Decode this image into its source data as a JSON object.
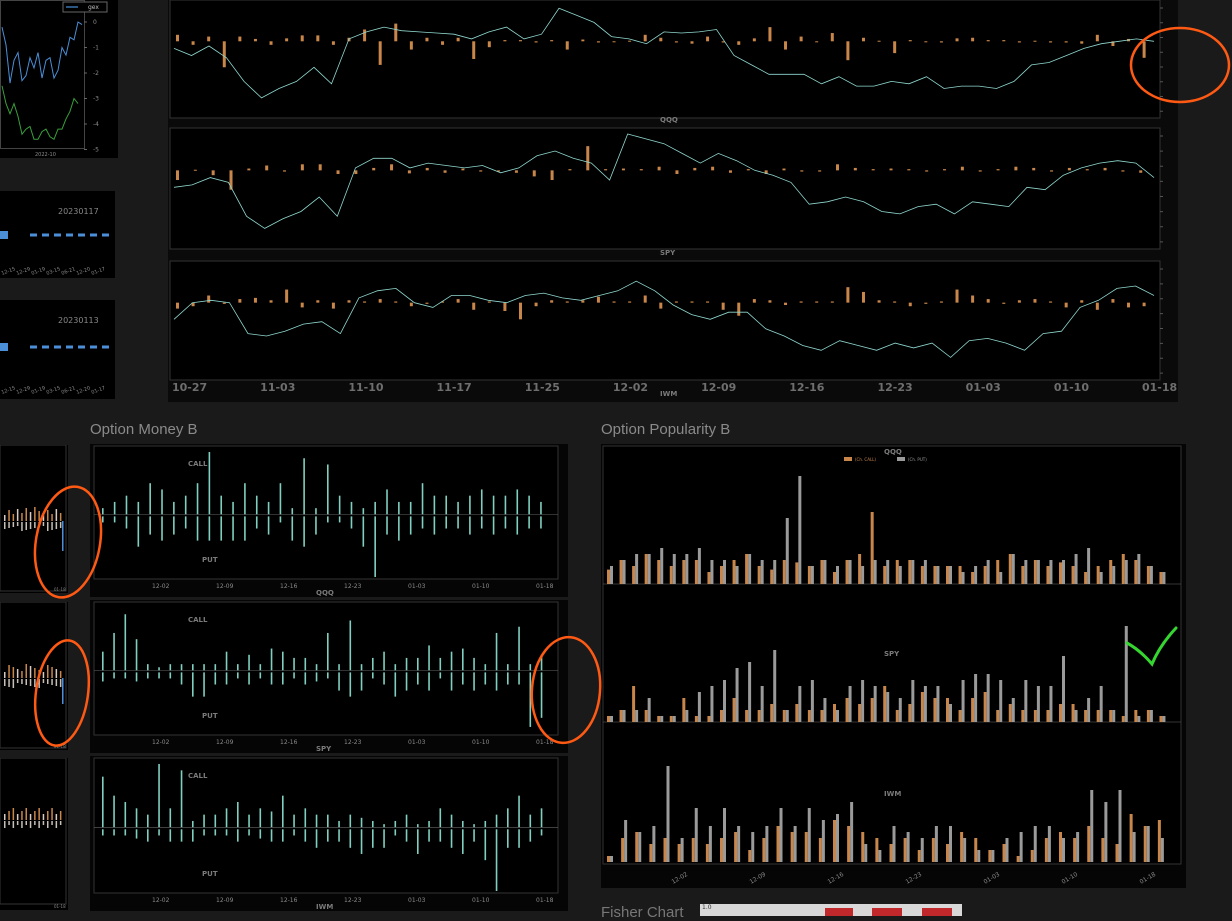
{
  "sections": {
    "money": "Option Money B",
    "popularity": "Option Popularity B",
    "fisher": "Fisher Chart",
    "fisher_scale": "1.0"
  },
  "colors": {
    "orange": "#c8864a",
    "teal": "#7fd0c0",
    "line": "#8fd8cf",
    "gray": "#9a9a9a",
    "blue": "#4a8fd8",
    "green": "#3aa03a",
    "annot": "#ff5a14",
    "check": "#36d630"
  },
  "gex": {
    "legend": "gex",
    "x_tick": "2022-10",
    "y_ticks": [
      "0",
      "-1",
      "-2",
      "-3",
      "-4",
      "-5"
    ],
    "blue": [
      -0.2,
      -0.9,
      -2.4,
      -1.5,
      -1.2,
      -2.3,
      -2.1,
      -1.4,
      -1.8,
      -1.2,
      -2.2,
      -1.5,
      -1.4,
      -2.2,
      -1.9,
      -1.0,
      -1.3,
      -0.6,
      -0.7,
      0.0,
      -0.1
    ],
    "green": [
      -2.5,
      -3.2,
      -3.6,
      -3.2,
      -3.7,
      -4.4,
      -4.2,
      -4.1,
      -4.6,
      -4.6,
      -4.3,
      -4.2,
      -4.5,
      -4.6,
      -4.2,
      -4.2,
      -3.8,
      -3.5,
      -3.0,
      -3.2
    ]
  },
  "dates": {
    "left_a": "20230117",
    "left_b": "20230113",
    "ticks": [
      "12-15",
      "12-29",
      "01-19",
      "03-15",
      "06-21",
      "12-20",
      "01-17"
    ],
    "ticks_b": [
      "12-15",
      "12-29",
      "01-19",
      "03-15",
      "06-21",
      "12-20",
      "01-17"
    ],
    "bar_a": [
      3
    ],
    "bar_b": [
      2
    ]
  },
  "ticker_labels": {
    "qqq": "QQQ",
    "spy": "SPY",
    "iwm": "IWM"
  },
  "call_put": {
    "call": "CALL",
    "put": "PUT"
  },
  "small_tick": "01-18",
  "chart_data": [
    {
      "type": "bar",
      "title": "QQQ",
      "xlabel": "QQQ",
      "series": [
        {
          "values": [
            0.55,
            -0.3,
            0.4,
            -2.2,
            0.4,
            0.2,
            -0.3,
            0.25,
            0.5,
            0.5,
            -0.3,
            0.3,
            1.0,
            -2.0,
            1.5,
            -0.7,
            0.3,
            -0.3,
            0.3,
            -1.5,
            -0.5,
            0.1,
            0.1,
            -0.1,
            0.1,
            -0.7,
            0.15,
            -0.1,
            -0.05,
            0.05,
            0.55,
            0.3,
            -0.1,
            -0.2,
            0.4,
            -0.1,
            -0.3,
            0.25,
            1.2,
            -0.7,
            0.4,
            -0.05,
            0.7,
            -1.6,
            0.3,
            0.05,
            -1.0,
            0.1,
            -0.05,
            -0.1,
            0.25,
            0.3,
            0.1,
            0.1,
            -0.1,
            0.05,
            -0.1,
            -0.1,
            -0.2,
            0.55,
            -0.4,
            0.2,
            -1.4
          ]
        },
        {
          "values": [
            0.2,
            -0.1,
            0.3,
            -0.2,
            -1.2,
            -1.9,
            -1.5,
            -1.2,
            -0.6,
            -1.3,
            0.6,
            0.9,
            1.1,
            0.95,
            0.9,
            0.85,
            0.8,
            0.6,
            0.9,
            1.1,
            0.6,
            0.8,
            1.9,
            1.6,
            1.3,
            0.7,
            0.6,
            0.4,
            0.9,
            0.85,
            0.9,
            1.0,
            -0.1,
            -0.5,
            -0.9,
            -0.9,
            -0.9,
            -1.3,
            -1.0,
            -1.4,
            -1.4,
            -1.2,
            -1.3,
            -1.0,
            -1.5,
            -1.4,
            -1.4,
            -1.5,
            -1.2,
            -0.5,
            -0.4,
            -0.1,
            0.2,
            0.4,
            0.5,
            0.6,
            0.5
          ]
        }
      ],
      "ylim": [
        -4,
        4
      ]
    },
    {
      "type": "bar",
      "title": "SPY",
      "xlabel": "SPY",
      "series": [
        {
          "values": [
            -0.8,
            0.05,
            -0.4,
            -1.6,
            0.15,
            0.4,
            -0.1,
            0.5,
            0.5,
            -0.3,
            -0.3,
            0.2,
            0.5,
            -0.25,
            0.2,
            -0.2,
            0.15,
            -0.1,
            -0.1,
            -0.2,
            -0.5,
            -0.8,
            0.1,
            2.0,
            0.1,
            0.15,
            0.1,
            0.3,
            -0.3,
            0.2,
            0.3,
            -0.2,
            0.1,
            -0.3,
            0.15,
            -0.1,
            -0.1,
            0.5,
            0.2,
            0.1,
            0.15,
            0.1,
            -0.1,
            0.1,
            0.3,
            -0.1,
            0.1,
            0.3,
            0.2,
            -0.1,
            0.2,
            0.1,
            0.2,
            -0.1,
            -0.2
          ]
        },
        {
          "values": [
            -0.2,
            -0.1,
            0.2,
            0.0,
            -1.4,
            -1.9,
            -1.5,
            -1.2,
            -0.6,
            -1.4,
            0.6,
            1.0,
            1.0,
            0.6,
            0.8,
            0.7,
            0.6,
            0.7,
            0.4,
            0.6,
            1.1,
            1.3,
            1.0,
            0.8,
            0.1,
            2.0,
            1.8,
            1.6,
            1.2,
            0.8,
            1.2,
            0.9,
            0.5,
            0.3,
            0.0,
            -0.9,
            -0.8,
            -0.6,
            -0.8,
            -1.2,
            -1.3,
            -1.0,
            -0.9,
            -1.3,
            -0.8,
            -0.9,
            -1.0,
            -0.2,
            -0.3,
            0.3,
            0.6,
            0.8,
            0.9,
            0.8,
            0.2
          ]
        }
      ],
      "ylim": [
        -4,
        4
      ]
    },
    {
      "type": "bar",
      "title": "IWM",
      "xlabel": "IWM",
      "x_ticks": [
        "10-27",
        "11-03",
        "11-10",
        "11-17",
        "11-25",
        "12-02",
        "12-09",
        "12-16",
        "12-23",
        "01-03",
        "01-10",
        "01-18"
      ],
      "series": [
        {
          "values": [
            -0.5,
            -0.3,
            0.6,
            -0.1,
            0.3,
            0.4,
            0.2,
            1.1,
            -0.4,
            0.2,
            -0.5,
            0.2,
            0.1,
            0.3,
            0.1,
            -0.3,
            -0.1,
            0.1,
            0.3,
            -0.6,
            0.1,
            -0.7,
            -1.4,
            -0.3,
            0.2,
            0.1,
            0.2,
            0.5,
            0.1,
            0.1,
            0.6,
            -0.5,
            0.1,
            0.1,
            0.1,
            -0.6,
            -1.1,
            0.3,
            0.2,
            -0.2,
            0.1,
            0.1,
            0.1,
            1.3,
            0.9,
            0.2,
            0.1,
            -0.3,
            -0.1,
            0.1,
            1.1,
            0.6,
            0.3,
            -0.1,
            0.2,
            0.3,
            0.1,
            -0.4,
            0.2,
            -0.6,
            0.3,
            -0.4,
            -0.3
          ]
        },
        {
          "values": [
            -0.2,
            0.5,
            0.6,
            0.5,
            -0.8,
            -0.9,
            -0.7,
            -0.4,
            -0.3,
            -0.8,
            0.7,
            1.0,
            1.1,
            0.5,
            0.3,
            0.8,
            0.8,
            0.6,
            0.5,
            0.8,
            0.9,
            0.7,
            0.6,
            0.8,
            1.0,
            1.4,
            1.0,
            0.4,
            0.0,
            -0.2,
            0.1,
            0.1,
            -0.6,
            -0.9,
            -1.3,
            -1.5,
            -1.1,
            -1.3,
            -1.5,
            -1.2,
            -1.4,
            -1.2,
            -1.8,
            -1.1,
            -1.0,
            -1.2,
            -1.5,
            -0.8,
            -0.7,
            0.3,
            0.6,
            1.1,
            1.2,
            0.8
          ]
        }
      ],
      "ylim": [
        -4,
        4
      ]
    },
    {
      "type": "bar",
      "title": "QQQ",
      "xlabel": "QQQ",
      "x_ticks": [
        "12-02",
        "12-09",
        "12-16",
        "12-23",
        "01-03",
        "01-10",
        "01-18"
      ],
      "series": [
        {
          "name": "CALL",
          "values": [
            0.1,
            0.2,
            0.3,
            0.2,
            0.5,
            0.4,
            0.2,
            0.3,
            0.5,
            1.0,
            0.3,
            0.2,
            0.5,
            0.3,
            0.2,
            0.5,
            0.1,
            0.9,
            0.1,
            0.8,
            0.3,
            0.2,
            0.1,
            0.2,
            0.4,
            0.2,
            0.2,
            0.5,
            0.3,
            0.3,
            0.2,
            0.3,
            0.4,
            0.3,
            0.3,
            0.4,
            0.3,
            0.2
          ]
        },
        {
          "name": "PUT",
          "values": [
            0.1,
            0.1,
            0.2,
            0.5,
            0.3,
            0.4,
            0.3,
            0.2,
            0.4,
            0.4,
            0.4,
            0.4,
            0.4,
            0.2,
            0.3,
            0.1,
            0.4,
            0.5,
            0.3,
            0.1,
            0.1,
            0.2,
            0.5,
            1.0,
            0.3,
            0.4,
            0.3,
            0.2,
            0.3,
            0.2,
            0.2,
            0.3,
            0.2,
            0.3,
            0.2,
            0.3,
            0.2,
            0.2
          ]
        }
      ],
      "ylim": [
        -1,
        1
      ]
    },
    {
      "type": "bar",
      "title": "SPY",
      "xlabel": "SPY",
      "x_ticks": [
        "12-02",
        "12-09",
        "12-16",
        "12-23",
        "01-03",
        "01-10",
        "01-18"
      ],
      "series": [
        {
          "name": "CALL",
          "values": [
            0.3,
            0.6,
            0.9,
            0.5,
            0.1,
            0.05,
            0.1,
            0.1,
            0.1,
            0.1,
            0.1,
            0.3,
            0.1,
            0.25,
            0.1,
            0.35,
            0.3,
            0.2,
            0.2,
            0.1,
            0.6,
            0.1,
            0.8,
            0.1,
            0.2,
            0.3,
            0.1,
            0.2,
            0.2,
            0.4,
            0.2,
            0.3,
            0.35,
            0.2,
            0.1,
            0.6,
            0.1,
            0.7,
            0.1,
            0.25
          ]
        },
        {
          "name": "PUT",
          "values": [
            0.15,
            0.1,
            0.1,
            0.15,
            0.1,
            0.1,
            0.1,
            0.2,
            0.4,
            0.4,
            0.2,
            0.2,
            0.1,
            0.2,
            0.1,
            0.2,
            0.2,
            0.1,
            0.2,
            0.15,
            0.1,
            0.3,
            0.4,
            0.3,
            0.1,
            0.2,
            0.4,
            0.3,
            0.2,
            0.3,
            0.1,
            0.3,
            0.2,
            0.3,
            0.2,
            0.3,
            0.2,
            0.2,
            0.9,
            0.75
          ]
        }
      ],
      "ylim": [
        -1,
        1
      ]
    },
    {
      "type": "bar",
      "title": "IWM",
      "xlabel": "IWM",
      "x_ticks": [
        "12-02",
        "12-09",
        "12-16",
        "12-23",
        "01-03",
        "01-10",
        "01-18"
      ],
      "series": [
        {
          "name": "CALL",
          "values": [
            0.8,
            0.5,
            0.4,
            0.3,
            0.2,
            1.0,
            0.3,
            0.9,
            0.1,
            0.2,
            0.2,
            0.3,
            0.4,
            0.2,
            0.3,
            0.25,
            0.5,
            0.2,
            0.3,
            0.2,
            0.2,
            0.1,
            0.2,
            0.15,
            0.1,
            0.05,
            0.1,
            0.2,
            0.05,
            0.1,
            0.3,
            0.2,
            0.1,
            0.05,
            0.1,
            0.2,
            0.3,
            0.5,
            0.2,
            0.3
          ]
        },
        {
          "name": "PUT",
          "values": [
            0.1,
            0.1,
            0.1,
            0.15,
            0.2,
            0.1,
            0.2,
            0.2,
            0.2,
            0.1,
            0.1,
            0.1,
            0.2,
            0.1,
            0.15,
            0.2,
            0.2,
            0.1,
            0.2,
            0.3,
            0.2,
            0.2,
            0.3,
            0.4,
            0.3,
            0.3,
            0.1,
            0.2,
            0.4,
            0.2,
            0.2,
            0.3,
            0.4,
            0.2,
            0.5,
            1.0,
            0.3,
            0.3,
            0.2,
            0.1
          ]
        }
      ],
      "ylim": [
        -1,
        1
      ]
    },
    {
      "type": "bar",
      "title": "QQQ",
      "legend": [
        "(Ch. CALL)",
        "(Ch. PUT)"
      ],
      "series": [
        {
          "name": "(Ch. CALL)",
          "values": [
            0.12,
            0.2,
            0.15,
            0.25,
            0.2,
            0.15,
            0.2,
            0.2,
            0.1,
            0.15,
            0.2,
            0.25,
            0.15,
            0.12,
            0.2,
            0.18,
            0.15,
            0.2,
            0.1,
            0.2,
            0.25,
            0.6,
            0.15,
            0.2,
            0.2,
            0.15,
            0.15,
            0.15,
            0.15,
            0.1,
            0.15,
            0.2,
            0.25,
            0.15,
            0.2,
            0.15,
            0.18,
            0.15,
            0.1,
            0.15,
            0.2,
            0.25,
            0.2,
            0.15,
            0.1
          ]
        },
        {
          "name": "(Ch. PUT)",
          "values": [
            0.15,
            0.2,
            0.25,
            0.25,
            0.3,
            0.25,
            0.25,
            0.3,
            0.2,
            0.2,
            0.15,
            0.25,
            0.2,
            0.2,
            0.55,
            0.9,
            0.15,
            0.2,
            0.15,
            0.2,
            0.15,
            0.2,
            0.2,
            0.15,
            0.2,
            0.2,
            0.15,
            0.15,
            0.1,
            0.15,
            0.2,
            0.1,
            0.25,
            0.2,
            0.2,
            0.2,
            0.2,
            0.25,
            0.3,
            0.1,
            0.15,
            0.2,
            0.25,
            0.15,
            0.1
          ]
        }
      ],
      "ylim": [
        0,
        1
      ]
    },
    {
      "type": "bar",
      "title": "SPY",
      "series": [
        {
          "name": "(Ch. CALL)",
          "values": [
            0.05,
            0.1,
            0.3,
            0.1,
            0.05,
            0.05,
            0.2,
            0.05,
            0.05,
            0.1,
            0.2,
            0.1,
            0.1,
            0.15,
            0.1,
            0.15,
            0.1,
            0.1,
            0.15,
            0.2,
            0.15,
            0.2,
            0.3,
            0.1,
            0.15,
            0.25,
            0.2,
            0.2,
            0.1,
            0.2,
            0.25,
            0.1,
            0.15,
            0.1,
            0.1,
            0.1,
            0.15,
            0.15,
            0.1,
            0.1,
            0.1,
            0.05,
            0.1,
            0.1,
            0.05
          ]
        },
        {
          "name": "(Ch. PUT)",
          "values": [
            0.05,
            0.1,
            0.1,
            0.2,
            0.05,
            0.05,
            0.1,
            0.25,
            0.3,
            0.35,
            0.45,
            0.5,
            0.3,
            0.6,
            0.1,
            0.3,
            0.35,
            0.2,
            0.1,
            0.3,
            0.35,
            0.3,
            0.25,
            0.2,
            0.35,
            0.3,
            0.3,
            0.15,
            0.35,
            0.4,
            0.4,
            0.35,
            0.2,
            0.35,
            0.3,
            0.3,
            0.55,
            0.1,
            0.2,
            0.3,
            0.1,
            0.8,
            0.05,
            0.1,
            0.05
          ]
        }
      ],
      "ylim": [
        0,
        1
      ]
    },
    {
      "type": "bar",
      "title": "IWM",
      "x_ticks": [
        "12-02",
        "12-09",
        "12-16",
        "12-23",
        "01-03",
        "01-10",
        "01-18"
      ],
      "series": [
        {
          "name": "(Ch. CALL)",
          "values": [
            0.05,
            0.2,
            0.25,
            0.15,
            0.2,
            0.15,
            0.2,
            0.15,
            0.2,
            0.25,
            0.1,
            0.2,
            0.3,
            0.25,
            0.25,
            0.2,
            0.35,
            0.3,
            0.25,
            0.2,
            0.15,
            0.2,
            0.1,
            0.2,
            0.15,
            0.25,
            0.2,
            0.1,
            0.15,
            0.05,
            0.1,
            0.2,
            0.25,
            0.2,
            0.3,
            0.2,
            0.15,
            0.4,
            0.3,
            0.35
          ]
        },
        {
          "name": "(Ch. PUT)",
          "values": [
            0.05,
            0.35,
            0.25,
            0.3,
            0.8,
            0.2,
            0.45,
            0.3,
            0.45,
            0.3,
            0.25,
            0.3,
            0.45,
            0.3,
            0.45,
            0.35,
            0.4,
            0.5,
            0.15,
            0.1,
            0.3,
            0.25,
            0.2,
            0.3,
            0.3,
            0.2,
            0.1,
            0.1,
            0.2,
            0.25,
            0.3,
            0.3,
            0.2,
            0.25,
            0.6,
            0.5,
            0.6,
            0.25,
            0.3,
            0.2
          ]
        }
      ],
      "ylim": [
        0,
        1
      ]
    }
  ]
}
